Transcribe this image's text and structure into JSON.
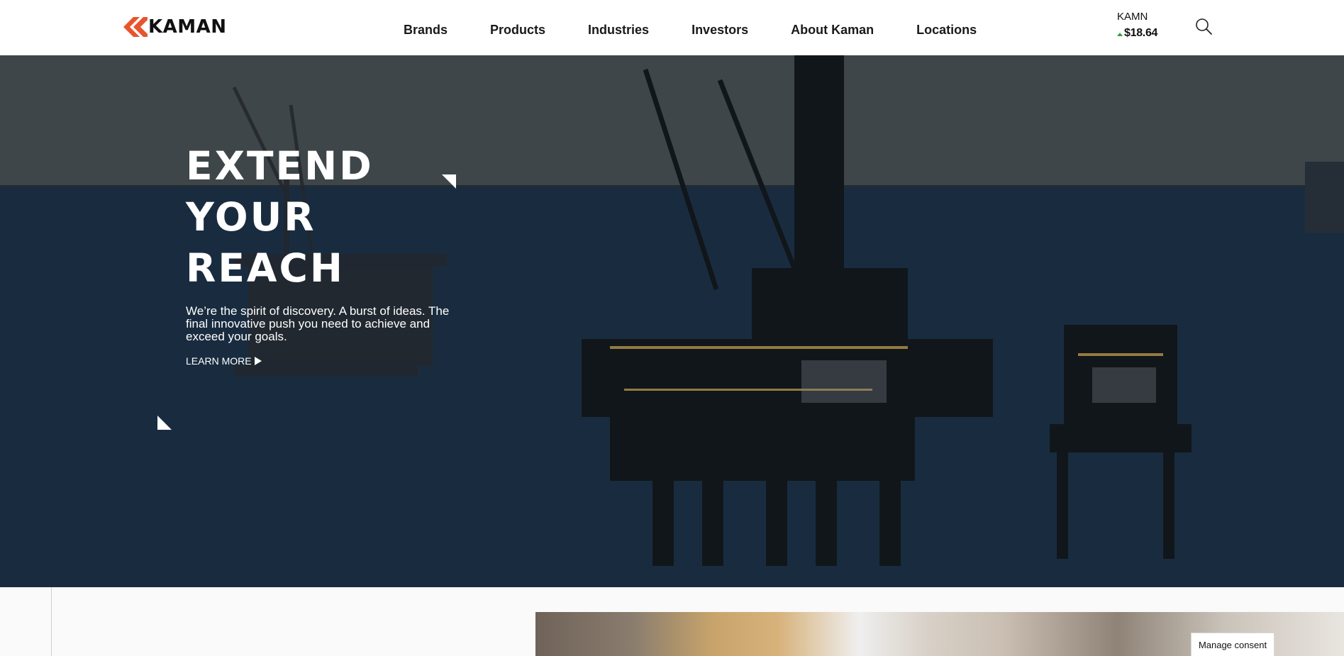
{
  "brand": {
    "name": "KAMAN",
    "accent": "#e8542c"
  },
  "nav": {
    "items": [
      {
        "label": "Brands"
      },
      {
        "label": "Products"
      },
      {
        "label": "Industries"
      },
      {
        "label": "Investors"
      },
      {
        "label": "About Kaman"
      },
      {
        "label": "Locations"
      }
    ]
  },
  "ticker": {
    "symbol": "KAMN",
    "price": "$18.64",
    "trend": "up",
    "trend_color": "#2e9e4a"
  },
  "search": {
    "icon": "search-icon"
  },
  "hero": {
    "title_lines": [
      "EXTEND",
      "YOUR",
      "REACH"
    ],
    "text": "We’re the spirit of discovery. A burst of ideas. The final innovative push you need to achieve and exceed your goals.",
    "cta_label": "LEARN MORE"
  },
  "consent": {
    "label": "Manage consent"
  }
}
